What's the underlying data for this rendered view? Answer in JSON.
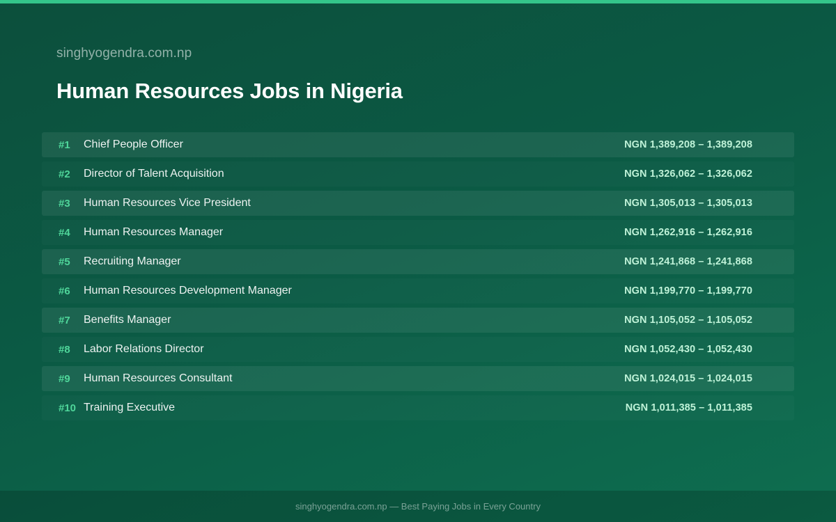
{
  "header": {
    "site_name": "singhyogendra.com.np",
    "title": "Human Resources Jobs in Nigeria"
  },
  "jobs": [
    {
      "rank": "#1",
      "title": "Chief People Officer",
      "salary": "NGN 1,389,208 – 1,389,208"
    },
    {
      "rank": "#2",
      "title": "Director of Talent Acquisition",
      "salary": "NGN 1,326,062 – 1,326,062"
    },
    {
      "rank": "#3",
      "title": "Human Resources Vice President",
      "salary": "NGN 1,305,013 – 1,305,013"
    },
    {
      "rank": "#4",
      "title": "Human Resources Manager",
      "salary": "NGN 1,262,916 – 1,262,916"
    },
    {
      "rank": "#5",
      "title": "Recruiting Manager",
      "salary": "NGN 1,241,868 – 1,241,868"
    },
    {
      "rank": "#6",
      "title": "Human Resources Development Manager",
      "salary": "NGN 1,199,770 – 1,199,770"
    },
    {
      "rank": "#7",
      "title": "Benefits Manager",
      "salary": "NGN 1,105,052 – 1,105,052"
    },
    {
      "rank": "#8",
      "title": "Labor Relations Director",
      "salary": "NGN 1,052,430 – 1,052,430"
    },
    {
      "rank": "#9",
      "title": "Human Resources Consultant",
      "salary": "NGN 1,024,015 – 1,024,015"
    },
    {
      "rank": "#10",
      "title": "Training Executive",
      "salary": "NGN 1,011,385 – 1,011,385"
    }
  ],
  "footer": {
    "text": "singhyogendra.com.np — Best Paying Jobs in Every Country"
  },
  "colors": {
    "accent": "#34c58a",
    "rank": "#4fd69a",
    "salary": "#bff2d8",
    "background": "#0b5a44"
  }
}
